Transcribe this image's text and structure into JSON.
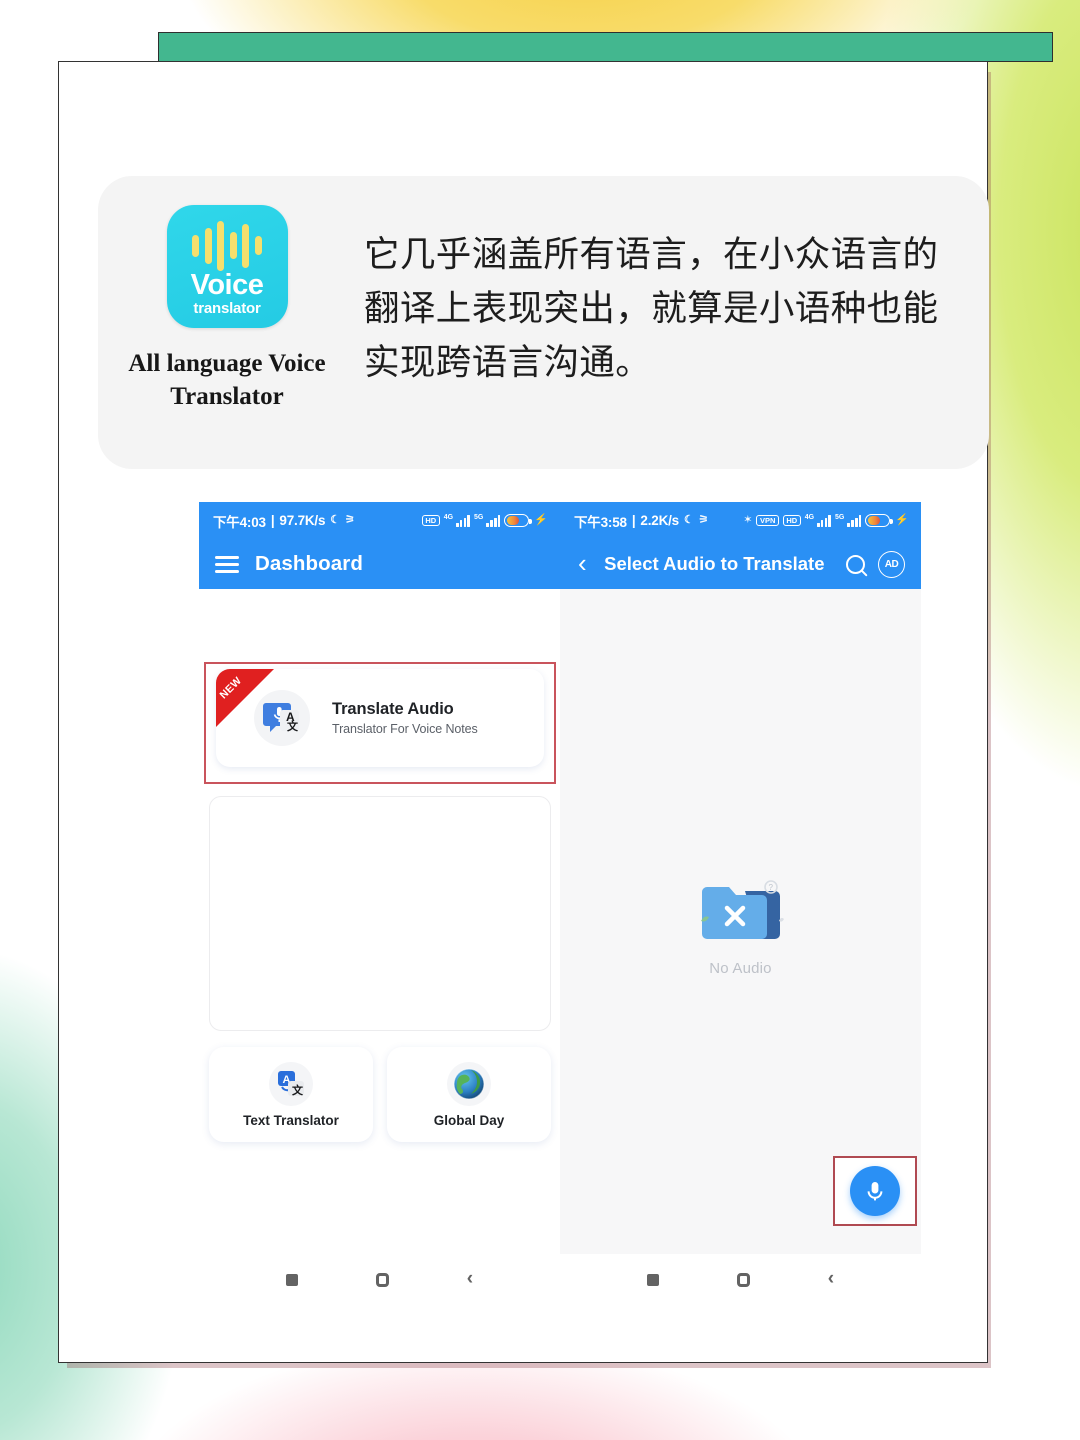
{
  "app": {
    "icon_word": "Voice",
    "icon_subword": "translator",
    "caption": "All language Voice Translator",
    "description": "它几乎涵盖所有语言，在小众语言的翻译上表现突出，就算是小语种也能实现跨语言沟通。"
  },
  "colors": {
    "accent_bar": "#43b78f",
    "app_bar": "#2a90f5",
    "icon_bg": "#2ad2e8",
    "highlight_border": "#c9545c",
    "ribbon": "#e02020"
  },
  "phone_left": {
    "status": {
      "time": "下午4:03",
      "separator": "|",
      "net_speed": "97.7K/s",
      "moon_icon": "☾",
      "mute_icon": "⚞",
      "hd_chip": "HD",
      "gen_1": "4G",
      "gen_2": "5G"
    },
    "appbar": {
      "title": "Dashboard"
    },
    "translate_card": {
      "ribbon": "NEW",
      "title": "Translate Audio",
      "subtitle": "Translator For Voice Notes",
      "icon_letter": "A",
      "icon_cjk": "文"
    },
    "tiles": [
      {
        "label": "Text Translator",
        "icon": "translate-icon"
      },
      {
        "label": "Global Day",
        "icon": "globe-icon"
      }
    ],
    "nav": {
      "recents": "recents-square-icon",
      "home": "home-circle-icon",
      "back": "‹"
    }
  },
  "phone_right": {
    "status": {
      "time": "下午3:58",
      "separator": "|",
      "net_speed": "2.2K/s",
      "moon_icon": "☾",
      "mute_icon": "⚞",
      "bluetooth_icon": "✶",
      "vpn_chip": "VPN",
      "hd_chip": "HD",
      "gen_1": "4G",
      "gen_2": "5G"
    },
    "appbar": {
      "back": "‹",
      "title": "Select Audio to Translate",
      "search": "search-icon",
      "ad": "AD"
    },
    "empty_state": {
      "label": "No Audio",
      "icon": "folder-x-icon"
    },
    "fab": {
      "icon": "microphone-icon"
    },
    "nav": {
      "recents": "recents-square-icon",
      "home": "home-circle-icon",
      "back": "‹"
    }
  }
}
